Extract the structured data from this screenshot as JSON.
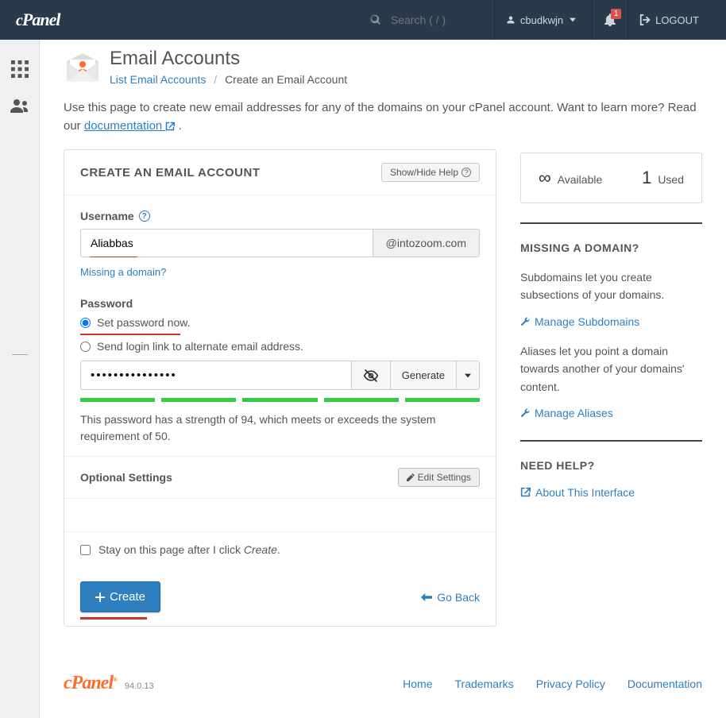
{
  "topbar": {
    "logo": "cPanel",
    "search_placeholder": "Search ( / )",
    "username": "cbudkwjn",
    "notify_count": "1",
    "logout": "LOGOUT"
  },
  "header": {
    "title": "Email Accounts",
    "breadcrumb_list": "List Email Accounts",
    "breadcrumb_current": "Create an Email Account"
  },
  "intro": {
    "text": "Use this page to create new email addresses for any of the domains on your cPanel account. Want to learn more? Read our ",
    "link": "documentation",
    "period": " ."
  },
  "form": {
    "section_title": "CREATE AN EMAIL ACCOUNT",
    "help_btn": "Show/Hide Help",
    "username_label": "Username",
    "username_value": "Aliabbas",
    "domain": "@intozoom.com",
    "missing_link": "Missing a domain?",
    "password_label": "Password",
    "radio_now": "Set password now.",
    "radio_link": "Send login link to alternate email address.",
    "password_value": "•••••••••••••••",
    "generate": "Generate",
    "strength_text": "This password has a strength of 94, which meets or exceeds the system requirement of 50.",
    "optional_title": "Optional Settings",
    "edit_settings": "Edit Settings",
    "stay_text": "Stay on this page after I click ",
    "stay_create": "Create",
    "stay_period": ".",
    "create_btn": "Create",
    "go_back": "Go Back"
  },
  "stats": {
    "available": "Available",
    "used": "Used",
    "used_val": "1"
  },
  "missing": {
    "title": "MISSING A DOMAIN?",
    "sub_text": "Subdomains let you create subsections of your domains.",
    "sub_link": "Manage Subdomains",
    "alias_text": "Aliases let you point a domain towards another of your domains' content.",
    "alias_link": "Manage Aliases"
  },
  "help": {
    "title": "NEED HELP?",
    "link": "About This Interface"
  },
  "footer": {
    "logo": "cPanel",
    "version": "94.0.13",
    "links": [
      "Home",
      "Trademarks",
      "Privacy Policy",
      "Documentation"
    ]
  }
}
